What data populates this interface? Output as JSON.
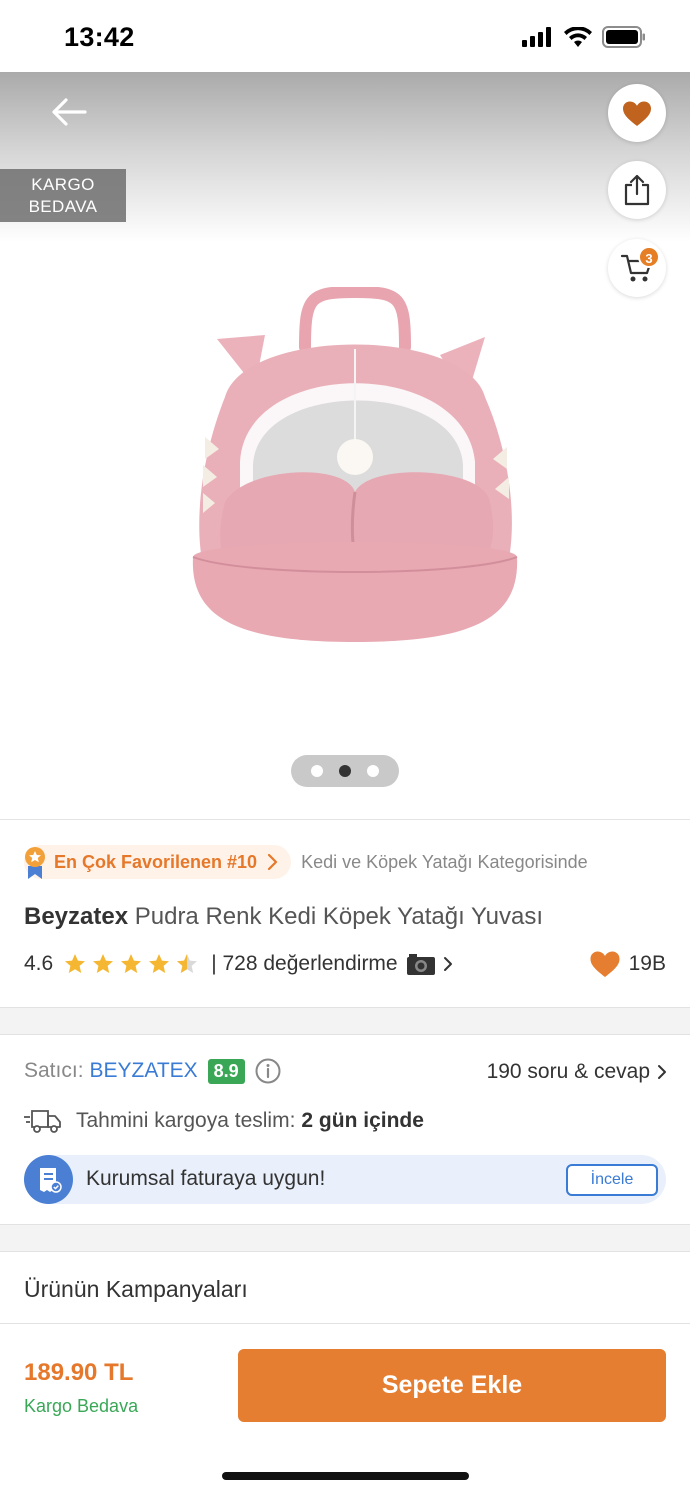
{
  "status_bar": {
    "time": "13:42"
  },
  "hero": {
    "kargo_badge_line1": "KARGO",
    "kargo_badge_line2": "BEDAVA",
    "cart_count": "3",
    "image_count": 3,
    "active_image_index": 1,
    "icons": [
      "back-arrow-icon",
      "heart-icon",
      "share-icon",
      "cart-icon"
    ]
  },
  "ranking": {
    "label": "En Çok Favorilenen #10",
    "category": "Kedi ve Köpek Yatağı Kategorisinde"
  },
  "product": {
    "brand": "Beyzatex",
    "name": "Pudra Renk Kedi Köpek Yatağı Yuvası",
    "rating": "4.6",
    "rating_stars": 4.6,
    "reviews": "| 728 değerlendirme",
    "favorites": "19B"
  },
  "seller": {
    "label": "Satıcı:",
    "name": "BEYZATEX",
    "score": "8.9",
    "qa_link": "190 soru & cevap",
    "delivery_label": "Tahmini kargoya teslim:",
    "delivery_value": "2 gün içinde",
    "invoice_text": "Kurumsal faturaya uygun!",
    "invoice_button": "İncele"
  },
  "campaigns": {
    "title": "Ürünün Kampanyaları"
  },
  "bottom_bar": {
    "price": "189.90 TL",
    "shipping": "Kargo Bedava",
    "add_to_cart": "Sepete Ekle"
  },
  "colors": {
    "accent": "#e57e30",
    "link": "#3a7bd5",
    "success": "#3aa757",
    "product_pink": "#e8aab4"
  }
}
